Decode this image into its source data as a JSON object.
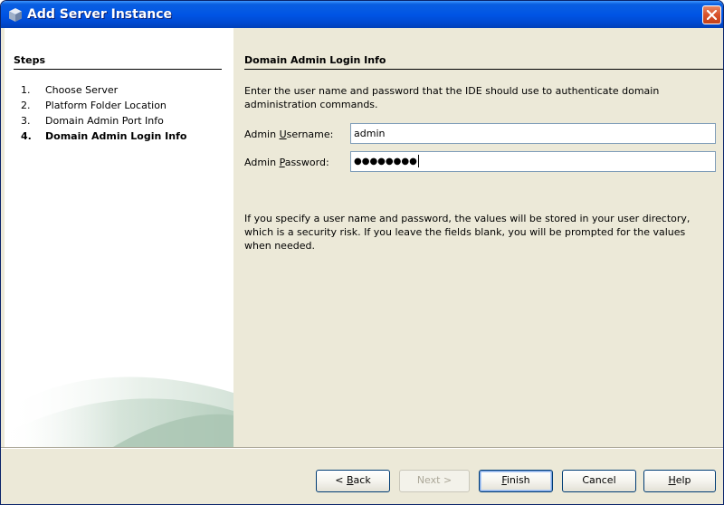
{
  "window": {
    "title": "Add Server Instance"
  },
  "steps": {
    "header": "Steps",
    "items": [
      {
        "number": "1.",
        "label": "Choose Server"
      },
      {
        "number": "2.",
        "label": "Platform Folder Location"
      },
      {
        "number": "3.",
        "label": "Domain Admin Port Info"
      },
      {
        "number": "4.",
        "label": "Domain Admin Login Info"
      }
    ],
    "current_index": 3
  },
  "content": {
    "header": "Domain Admin Login Info",
    "description": "Enter the user name and password that the IDE should use to authenticate domain administration commands.",
    "username": {
      "label_pre": "Admin ",
      "label_mnemonic": "U",
      "label_post": "sername:",
      "value": "admin"
    },
    "password": {
      "label_pre": "Admin ",
      "label_mnemonic": "P",
      "label_post": "assword:",
      "masked_value": "●●●●●●●●"
    },
    "note": "If you specify a user name and password, the values will be stored in your user directory, which is a security risk. If you leave the fields blank, you will be prompted for the values when needed."
  },
  "buttons": {
    "back": {
      "pre": "< ",
      "mnemonic": "B",
      "post": "ack"
    },
    "next": {
      "label": "Next >"
    },
    "finish": {
      "pre": "",
      "mnemonic": "F",
      "post": "inish"
    },
    "cancel": {
      "label": "Cancel"
    },
    "help": {
      "pre": "",
      "mnemonic": "H",
      "post": "elp"
    }
  },
  "colors": {
    "titlebar": "#0055e5",
    "dialog_bg": "#ece9d8",
    "close_button": "#d8512a",
    "button_border": "#003c74"
  },
  "icons": {
    "window": "server-cube-icon",
    "close": "close-icon"
  }
}
